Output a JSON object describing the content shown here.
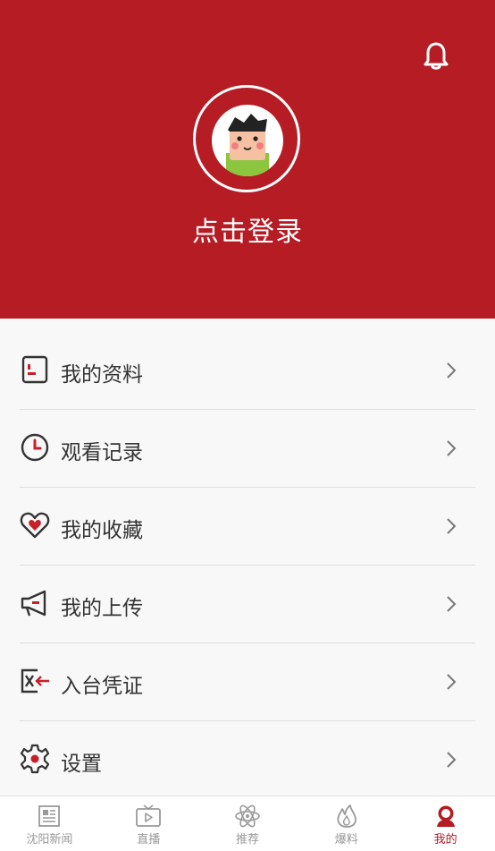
{
  "header": {
    "login_text": "点击登录"
  },
  "menu": [
    {
      "label": "我的资料",
      "icon": "profile-icon"
    },
    {
      "label": "观看记录",
      "icon": "clock-icon"
    },
    {
      "label": "我的收藏",
      "icon": "heart-icon"
    },
    {
      "label": "我的上传",
      "icon": "megaphone-icon"
    },
    {
      "label": "入台凭证",
      "icon": "pass-icon"
    },
    {
      "label": "设置",
      "icon": "gear-icon"
    }
  ],
  "tabs": [
    {
      "label": "沈阳新闻",
      "icon": "newspaper-icon",
      "active": false
    },
    {
      "label": "直播",
      "icon": "tv-icon",
      "active": false
    },
    {
      "label": "推荐",
      "icon": "atom-icon",
      "active": false
    },
    {
      "label": "爆料",
      "icon": "flame-icon",
      "active": false
    },
    {
      "label": "我的",
      "icon": "user-icon",
      "active": true
    }
  ],
  "colors": {
    "brand": "#b51c24",
    "tab_inactive": "#999999"
  }
}
